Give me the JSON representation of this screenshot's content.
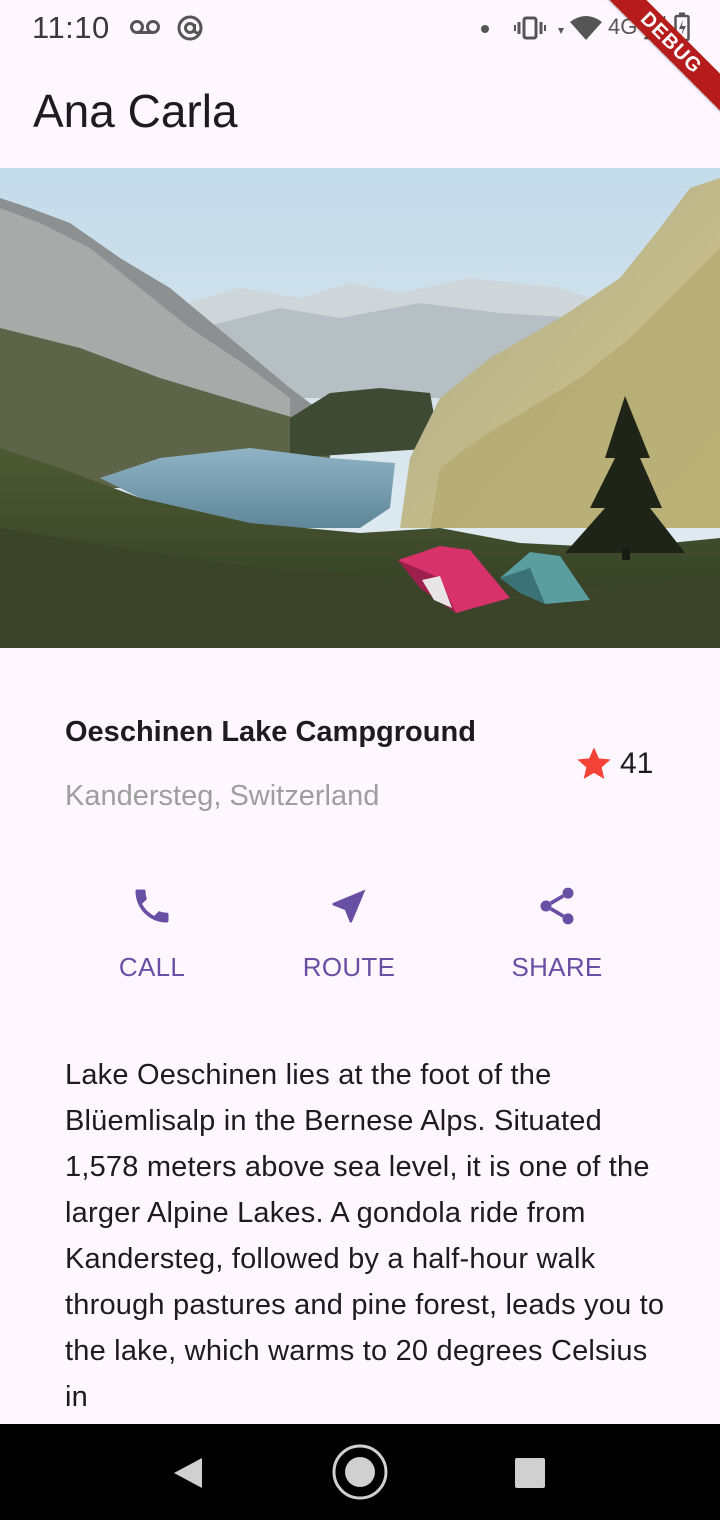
{
  "status_bar": {
    "time": "11:10",
    "network": "4G",
    "debug_label": "DEBUG"
  },
  "app_bar": {
    "title": "Ana Carla"
  },
  "hero": {
    "icon": "landscape-photo"
  },
  "place": {
    "title": "Oeschinen Lake Campground",
    "subtitle": "Kandersteg, Switzerland",
    "rating_count": "41",
    "star_color": "#f44336"
  },
  "actions": [
    {
      "label": "CALL",
      "icon": "phone-icon"
    },
    {
      "label": "ROUTE",
      "icon": "near-me-icon"
    },
    {
      "label": "SHARE",
      "icon": "share-icon"
    }
  ],
  "accent_color": "#6750a4",
  "description": "Lake Oeschinen lies at the foot of the Blüemlisalp in the Bernese Alps. Situated 1,578 meters above sea level, it is one of the larger Alpine Lakes. A gondola ride from Kandersteg, followed by a half-hour walk through pastures and pine forest, leads you to the lake, which warms to 20 degrees Celsius in"
}
